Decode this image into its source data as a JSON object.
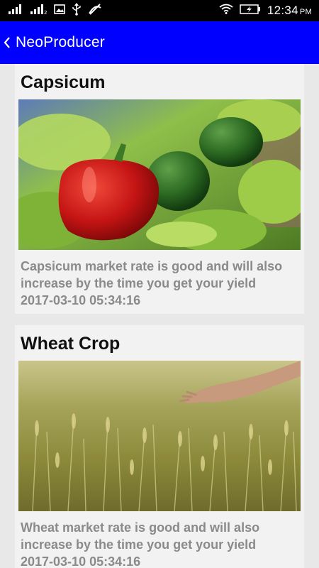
{
  "status_bar": {
    "time": "12:34",
    "ampm": "PM",
    "icons": [
      "signal-1-icon",
      "signal-2-icon",
      "image-icon",
      "usb-icon",
      "no-signal-icon",
      "wifi-icon",
      "battery-charging-icon"
    ]
  },
  "app_bar": {
    "title": "NeoProducer",
    "color": "#0000ff"
  },
  "feed": {
    "items": [
      {
        "title": "Capsicum",
        "image": "capsicum-photo",
        "description": "Capsicum market rate is good and will also increase by the time you get your yield",
        "date": "2017-03-10 05:34:16"
      },
      {
        "title": "Wheat Crop",
        "image": "wheat-crop-photo",
        "description": "Wheat market rate is good and will also increase by the time you get your yield",
        "date": "2017-03-10 05:34:16"
      }
    ]
  }
}
